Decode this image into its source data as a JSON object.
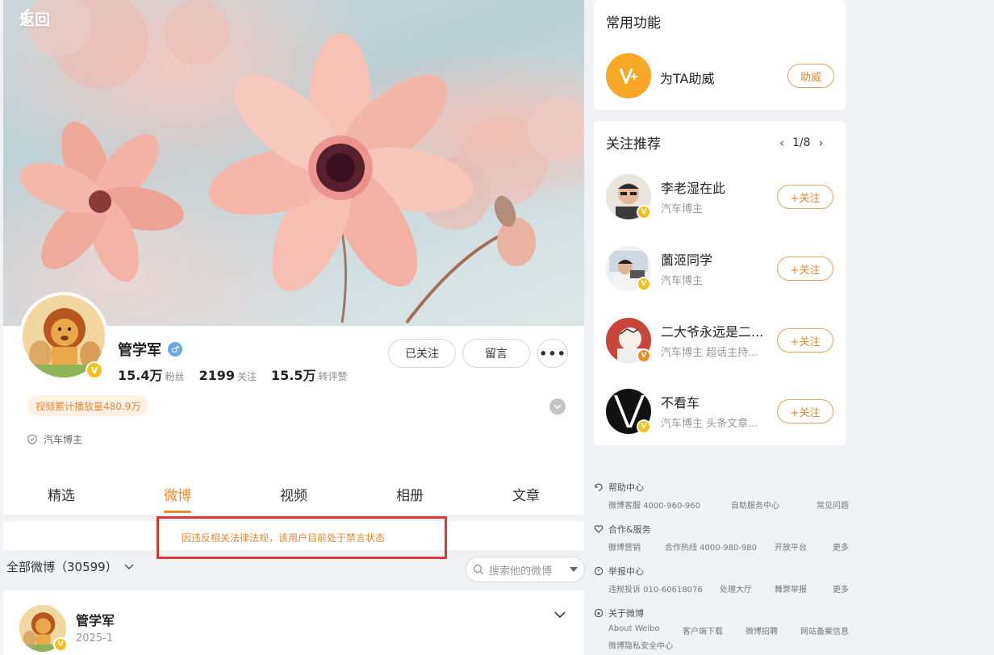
{
  "header": {
    "back_label": "返回"
  },
  "profile": {
    "name": "管学军",
    "followers_num": "15.4万",
    "followers_label": "粉丝",
    "following_num": "2199",
    "following_label": "关注",
    "reposts_num": "15.5万",
    "reposts_label": "转评赞",
    "followed_label": "已关注",
    "message_label": "留言",
    "more_label": "•••",
    "video_plays": "视频累计播放量480.9万",
    "role": "汽车博主"
  },
  "tabs": [
    "精选",
    "微博",
    "视频",
    "相册",
    "文章"
  ],
  "active_tab": "微博",
  "notice": "因违反相关法律法规，该用户目前处于禁言状态",
  "filter": {
    "label": "全部微博（30599）",
    "search_placeholder": "搜索他的微博"
  },
  "post": {
    "author": "管学军",
    "date": "2025-1"
  },
  "sidebar": {
    "common_title": "常用功能",
    "common_item_label": "为TA助威",
    "common_item_button": "助威",
    "recommend_title": "关注推荐",
    "pager": "1/8",
    "recommendations": [
      {
        "name": "李老湿在此",
        "desc": "汽车博主",
        "button": "+关注"
      },
      {
        "name": "薗洍同学",
        "desc": "汽车博主",
        "button": "+关注"
      },
      {
        "name": "二大爷永远是二...",
        "desc": "汽车博主 超话主持...",
        "button": "+关注"
      },
      {
        "name": "不看车",
        "desc": "汽车博主 头条文章...",
        "button": "+关注"
      }
    ]
  },
  "footer": {
    "help": {
      "title": "帮助中心",
      "links": [
        "微博客服 4000-960-960",
        "自助服务中心",
        "常见问题"
      ]
    },
    "coop": {
      "title": "合作&服务",
      "links": [
        "微博营销",
        "合作热线 4000-980-980",
        "开放平台",
        "更多"
      ]
    },
    "report": {
      "title": "举报中心",
      "links": [
        "违规投诉 010-60618076",
        "处理大厅",
        "舞弊举报",
        "更多"
      ]
    },
    "about": {
      "title": "关于微博",
      "links": [
        "About Weibo",
        "客户端下载",
        "微博招聘",
        "网站备案信息",
        "微博隐私安全中心"
      ]
    }
  },
  "colors": {
    "accent": "#ee8a22",
    "notice_border": "#d93a32",
    "badge": "#f7c11b"
  }
}
